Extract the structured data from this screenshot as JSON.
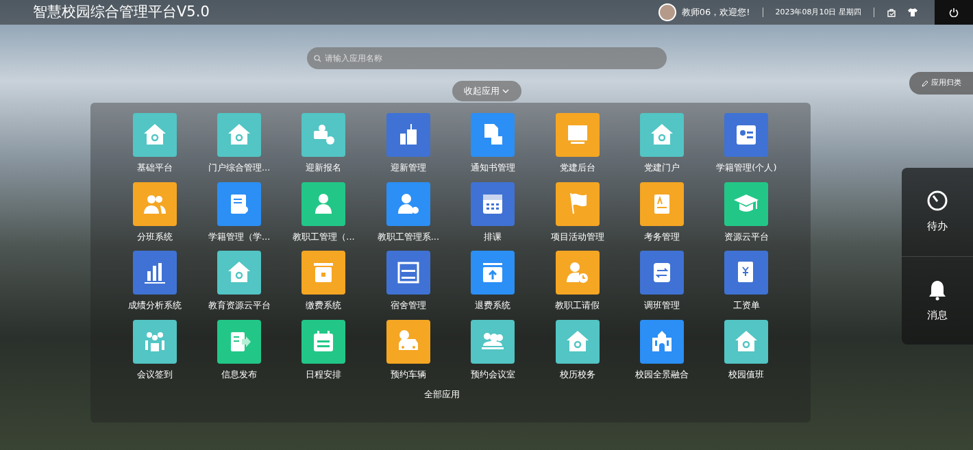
{
  "header": {
    "title": "智慧校园综合管理平台V5.0",
    "greeting": "教师06，欢迎您!",
    "date": "2023年08月10日 星期四"
  },
  "search": {
    "placeholder": "请输入应用名称"
  },
  "collapse_button": {
    "label": "收起应用",
    "expanded": true
  },
  "category_button": {
    "label": "应用归类"
  },
  "apps": [
    {
      "label": "基础平台",
      "color": "#52c5c4"
    },
    {
      "label": "门户综合管理...",
      "color": "#52c5c4"
    },
    {
      "label": "迎新报名",
      "color": "#52c5c4"
    },
    {
      "label": "迎新管理",
      "color": "#3f72d4"
    },
    {
      "label": "通知书管理",
      "color": "#2b8ff5"
    },
    {
      "label": "党建后台",
      "color": "#f5a623"
    },
    {
      "label": "党建门户",
      "color": "#52c5c4"
    },
    {
      "label": "学籍管理(个人)",
      "color": "#3f72d4"
    },
    {
      "label": "分班系统",
      "color": "#f5a623"
    },
    {
      "label": "学籍管理（学...",
      "color": "#2b8ff5"
    },
    {
      "label": "教职工管理（...",
      "color": "#22c787"
    },
    {
      "label": "教职工管理系...",
      "color": "#2b8ff5"
    },
    {
      "label": "排课",
      "color": "#3f72d4"
    },
    {
      "label": "项目活动管理",
      "color": "#f5a623"
    },
    {
      "label": "考务管理",
      "color": "#f5a623"
    },
    {
      "label": "资源云平台",
      "color": "#22c787"
    },
    {
      "label": "成绩分析系统",
      "color": "#3f72d4"
    },
    {
      "label": "教育资源云平台",
      "color": "#52c5c4"
    },
    {
      "label": "缴费系统",
      "color": "#f5a623"
    },
    {
      "label": "宿舍管理",
      "color": "#3f72d4"
    },
    {
      "label": "退费系统",
      "color": "#2b8ff5"
    },
    {
      "label": "教职工请假",
      "color": "#f5a623"
    },
    {
      "label": "调班管理",
      "color": "#3f72d4"
    },
    {
      "label": "工资单",
      "color": "#3f72d4"
    },
    {
      "label": "会议签到",
      "color": "#52c5c4"
    },
    {
      "label": "信息发布",
      "color": "#22c787"
    },
    {
      "label": "日程安排",
      "color": "#22c787"
    },
    {
      "label": "预约车辆",
      "color": "#f5a623"
    },
    {
      "label": "预约会议室",
      "color": "#52c5c4"
    },
    {
      "label": "校历校务",
      "color": "#52c5c4"
    },
    {
      "label": "校园全景融合",
      "color": "#2b8ff5"
    },
    {
      "label": "校园值班",
      "color": "#52c5c4"
    }
  ],
  "all_apps_link": "全部应用",
  "side_panel": [
    {
      "label": "待办"
    },
    {
      "label": "消息"
    }
  ]
}
